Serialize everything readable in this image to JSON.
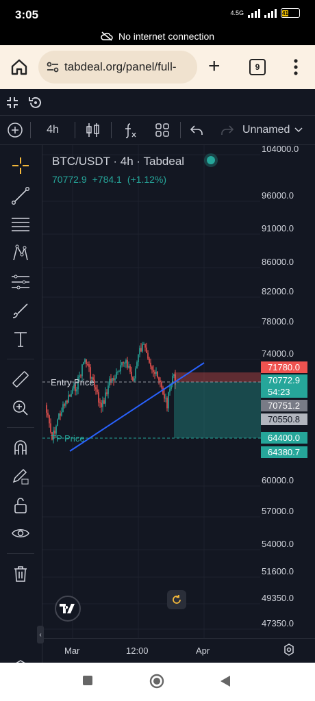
{
  "status": {
    "time": "3:05",
    "network": "4.5G",
    "battery": "41"
  },
  "connection_banner": "No internet connection",
  "browser": {
    "url": "tabdeal.org/panel/full-",
    "tab_count": "9"
  },
  "toolbar": {
    "interval": "4h",
    "layout_name": "Unnamed"
  },
  "legend": {
    "symbol_line": "BTC/USDT · 4h · Tabdeal",
    "last": "70772.9",
    "change": "+784.1",
    "change_pct": "(+1.12%)"
  },
  "price_axis": [
    "104000.0",
    "96000.0",
    "91000.0",
    "86000.0",
    "82000.0",
    "78000.0",
    "74000.0",
    "60000.0",
    "57000.0",
    "54000.0",
    "51600.0",
    "49350.0",
    "47350.0"
  ],
  "price_badges": {
    "sl": "71780.0",
    "last": "70772.9",
    "countdown": "54:23",
    "b1": "70751.2",
    "b2": "70550.8",
    "tp1": "64400.0",
    "tp2": "64380.7"
  },
  "annotations": {
    "entry": "Entry Price",
    "tp": "TP Price"
  },
  "time_axis": [
    "Mar",
    "12:00",
    "Apr"
  ],
  "colors": {
    "bg": "#131722",
    "up": "#26a69a",
    "down": "#ef5350",
    "trendline": "#2962ff",
    "accent": "#f5b93b"
  }
}
